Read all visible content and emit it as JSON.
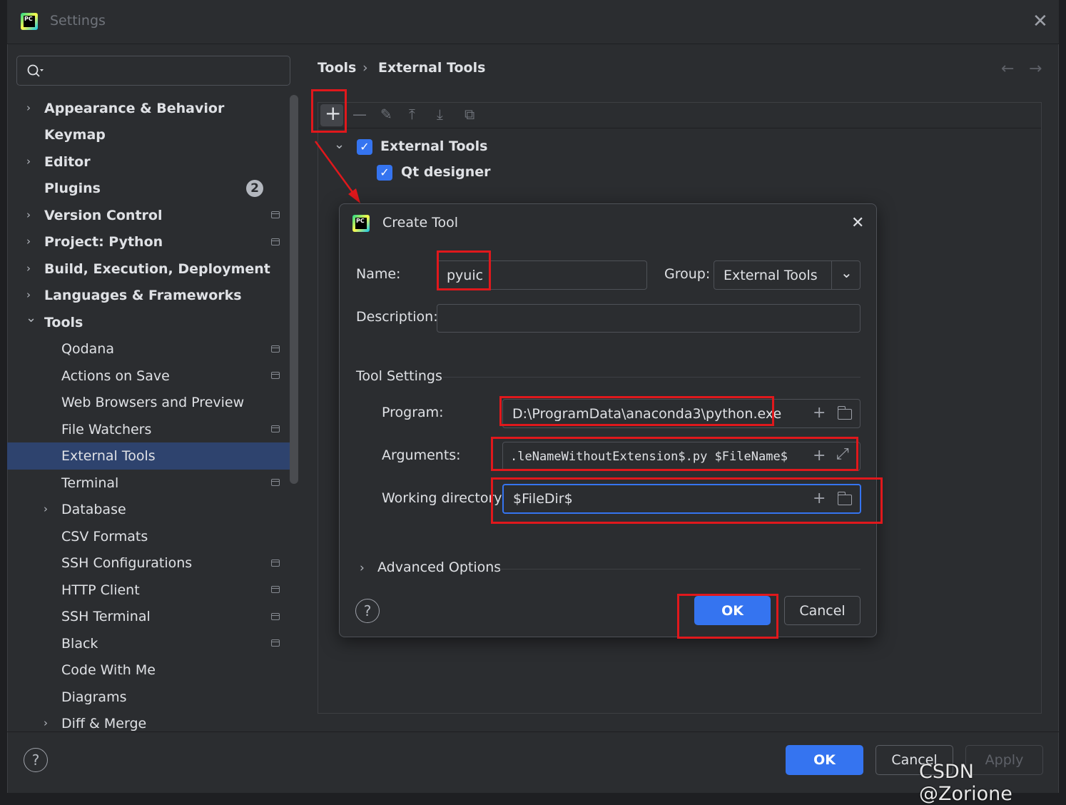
{
  "window": {
    "title": "Settings",
    "logo_text": "PC"
  },
  "search": {
    "placeholder": ""
  },
  "sidebar": {
    "items": [
      {
        "label": "Appearance & Behavior",
        "chevron": "›"
      },
      {
        "label": "Keymap"
      },
      {
        "label": "Editor",
        "chevron": "›"
      },
      {
        "label": "Plugins",
        "badge": "2"
      },
      {
        "label": "Version Control",
        "chevron": "›"
      },
      {
        "label": "Project: Python",
        "chevron": "›"
      },
      {
        "label": "Build, Execution, Deployment",
        "chevron": "›"
      },
      {
        "label": "Languages & Frameworks",
        "chevron": "›"
      },
      {
        "label": "Tools",
        "chevron": "⌄"
      },
      {
        "label": "Qodana"
      },
      {
        "label": "Actions on Save"
      },
      {
        "label": "Web Browsers and Preview"
      },
      {
        "label": "File Watchers"
      },
      {
        "label": "External Tools"
      },
      {
        "label": "Terminal"
      },
      {
        "label": "Database",
        "chevron": "›"
      },
      {
        "label": "CSV Formats"
      },
      {
        "label": "SSH Configurations"
      },
      {
        "label": "HTTP Client"
      },
      {
        "label": "SSH Terminal"
      },
      {
        "label": "Black"
      },
      {
        "label": "Code With Me"
      },
      {
        "label": "Diagrams"
      },
      {
        "label": "Diff & Merge",
        "chevron": "›"
      }
    ]
  },
  "breadcrumb": {
    "parent": "Tools",
    "separator": "›",
    "current": "External Tools"
  },
  "nav": {
    "back": "←",
    "forward": "→"
  },
  "toolbar": {
    "add": "+",
    "remove": "—",
    "edit": "✎",
    "up": "⤒",
    "down": "⤓",
    "copy": "⧉"
  },
  "tools_tree": {
    "group": {
      "label": "External Tools",
      "chevron": "⌄",
      "check": "✓"
    },
    "child": {
      "label": "Qt designer",
      "check": "✓"
    }
  },
  "dialog": {
    "title": "Create Tool",
    "close": "✕",
    "name_label": "Name:",
    "name_value": "pyuic",
    "group_label": "Group:",
    "group_value": "External Tools",
    "group_chevron": "⌄",
    "description_label": "Description:",
    "description_value": "",
    "tool_settings_label": "Tool Settings",
    "program_label": "Program:",
    "program_value": "D:\\ProgramData\\anaconda3\\python.exe",
    "arguments_label": "Arguments:",
    "arguments_value": ".leNameWithoutExtension$.py $FileName$",
    "workdir_label": "Working directory:",
    "workdir_value": "$FileDir$",
    "plus": "+",
    "expand": "⤢",
    "advanced_label": "Advanced Options",
    "advanced_chevron": "›",
    "help": "?",
    "ok": "OK",
    "cancel": "Cancel"
  },
  "footer": {
    "help": "?",
    "ok": "OK",
    "cancel": "Cancel",
    "apply": "Apply"
  },
  "watermark": "CSDN @Zorione",
  "colors": {
    "accent": "#3574f0",
    "annotation": "#e0181c",
    "selection": "#2e436e",
    "background": "#2b2d30"
  },
  "icons": [
    "search-icon",
    "close-icon",
    "chevron-right-icon",
    "chevron-down-icon",
    "add-icon",
    "remove-icon",
    "edit-icon",
    "move-up-icon",
    "move-down-icon",
    "copy-icon",
    "folder-icon",
    "expand-icon",
    "help-icon",
    "project-level-icon",
    "arrow-left-icon",
    "arrow-right-icon"
  ]
}
